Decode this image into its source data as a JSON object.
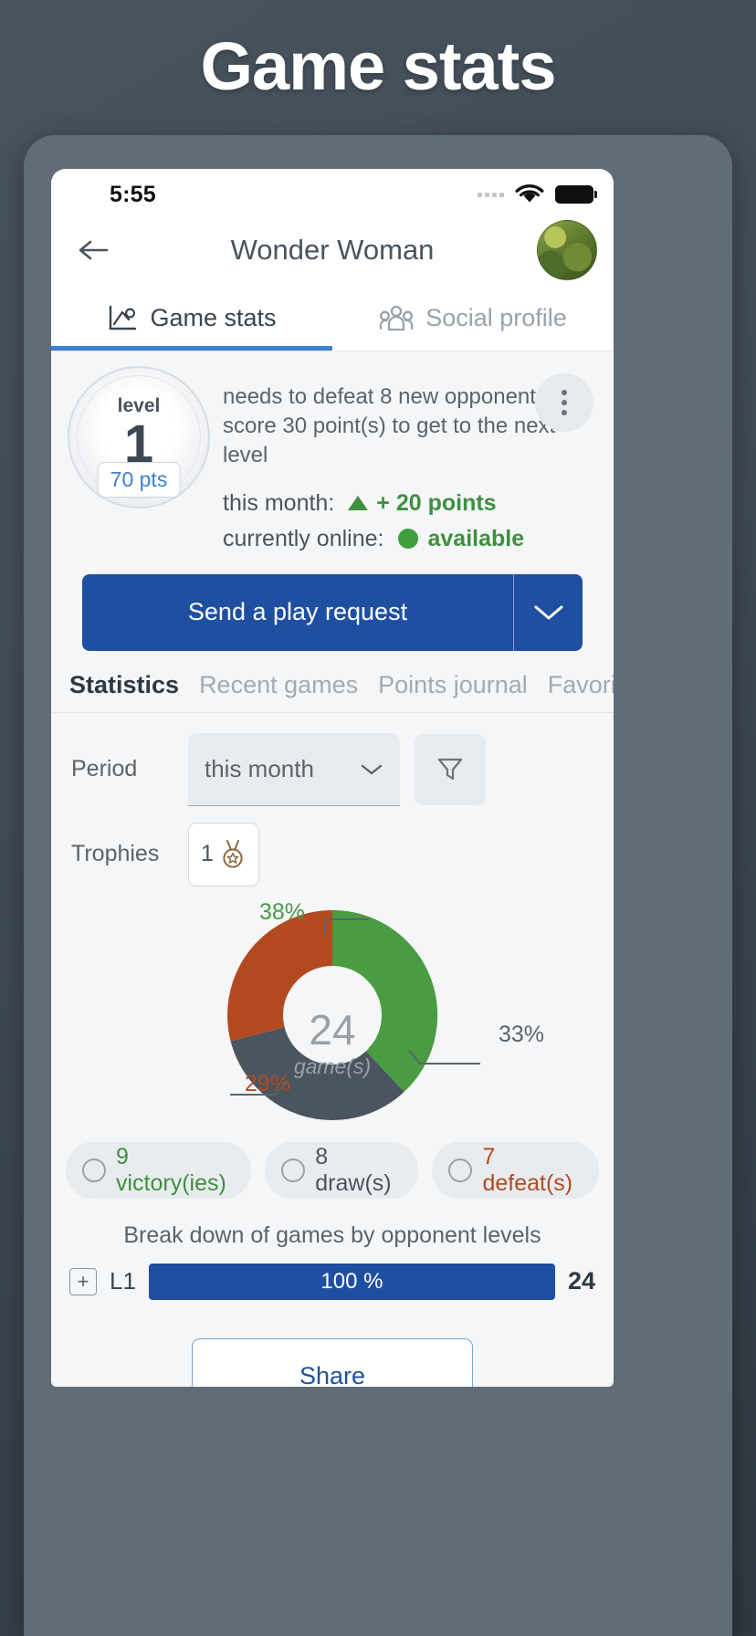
{
  "hero": {
    "title": "Game stats"
  },
  "status_bar": {
    "time": "5:55",
    "signal_icon": "signal-dots-icon",
    "wifi_icon": "wifi-icon",
    "battery_icon": "battery-full-icon"
  },
  "header": {
    "back_icon": "back-arrow-icon",
    "title": "Wonder Woman",
    "avatar_icon": "user-avatar"
  },
  "main_tabs": [
    {
      "label": "Game stats",
      "icon": "chart-stats-icon",
      "active": true
    },
    {
      "label": "Social profile",
      "icon": "people-group-icon",
      "active": false
    }
  ],
  "level": {
    "word": "level",
    "number": "1",
    "points_badge": "70 pts",
    "need_text": "needs to defeat 8 new opponents and score 30 point(s) to get to the next level",
    "month_label": "this month:",
    "month_value": "+ 20 points",
    "month_trend_icon": "triangle-up-icon",
    "online_label": "currently online:",
    "online_value": "available",
    "online_dot_icon": "status-dot-icon",
    "more_icon": "kebab-menu-icon"
  },
  "cta": {
    "label": "Send a play request",
    "caret_icon": "chevron-down-icon"
  },
  "sub_tabs": [
    {
      "label": "Statistics",
      "active": true
    },
    {
      "label": "Recent games",
      "active": false
    },
    {
      "label": "Points journal",
      "active": false
    },
    {
      "label": "Favorite ga",
      "active": false
    }
  ],
  "filters": {
    "period_label": "Period",
    "period_value": "this month",
    "period_caret_icon": "dropdown-caret-icon",
    "funnel_icon": "filter-funnel-icon",
    "trophies_label": "Trophies",
    "trophies_count": "1",
    "trophy_icon": "medal-icon"
  },
  "chart_data": {
    "type": "pie",
    "title": "",
    "center_value": "24",
    "center_label": "game(s)",
    "categories": [
      "victory(ies)",
      "draw(s)",
      "defeat(s)"
    ],
    "values": [
      9,
      8,
      7
    ],
    "percent_labels": [
      "38%",
      "33%",
      "29%"
    ],
    "colors": [
      "#4a9c42",
      "#4a5560",
      "#b34a1f"
    ],
    "legend_position": "bottom",
    "slices": [
      {
        "name": "victories",
        "count": 9,
        "percent": 38,
        "label": "38%",
        "color": "#4a9c42"
      },
      {
        "name": "draws",
        "count": 8,
        "percent": 33,
        "label": "33%",
        "color": "#4a5560"
      },
      {
        "name": "defeats",
        "count": 7,
        "percent": 29,
        "label": "29%",
        "color": "#b34a1f"
      }
    ]
  },
  "legend": [
    {
      "label": "9 victory(ies)",
      "kind": "win",
      "radio_icon": "radio-circle-icon"
    },
    {
      "label": "8 draw(s)",
      "kind": "draw",
      "radio_icon": "radio-circle-icon"
    },
    {
      "label": "7 defeat(s)",
      "kind": "loss",
      "radio_icon": "radio-circle-icon"
    }
  ],
  "breakdown": {
    "title": "Break down of games by opponent levels",
    "expand_icon": "plus-box-icon",
    "rows": [
      {
        "level": "L1",
        "percent_label": "100 %",
        "percent": 100,
        "count": "24"
      }
    ]
  },
  "share": {
    "label": "Share"
  }
}
